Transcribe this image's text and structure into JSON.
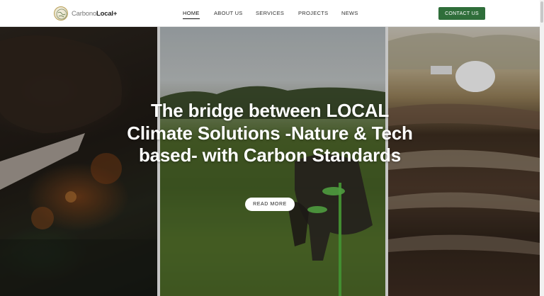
{
  "brand": {
    "name_part1": "Carbono",
    "name_part2": "Local+"
  },
  "nav": {
    "items": [
      {
        "label": "HOME",
        "active": true
      },
      {
        "label": "ABOUT US",
        "active": false
      },
      {
        "label": "SERVICES",
        "active": false
      },
      {
        "label": "PROJECTS",
        "active": false
      },
      {
        "label": "NEWS",
        "active": false
      }
    ],
    "cta_label": "CONTACT US"
  },
  "hero": {
    "title": "The bridge between LOCAL Climate Solutions -Nature & Tech based- with Carbon Standards",
    "button_label": "READ MORE"
  },
  "colors": {
    "cta_green": "#2f6e3a",
    "logo_gold": "#b9a15a"
  }
}
